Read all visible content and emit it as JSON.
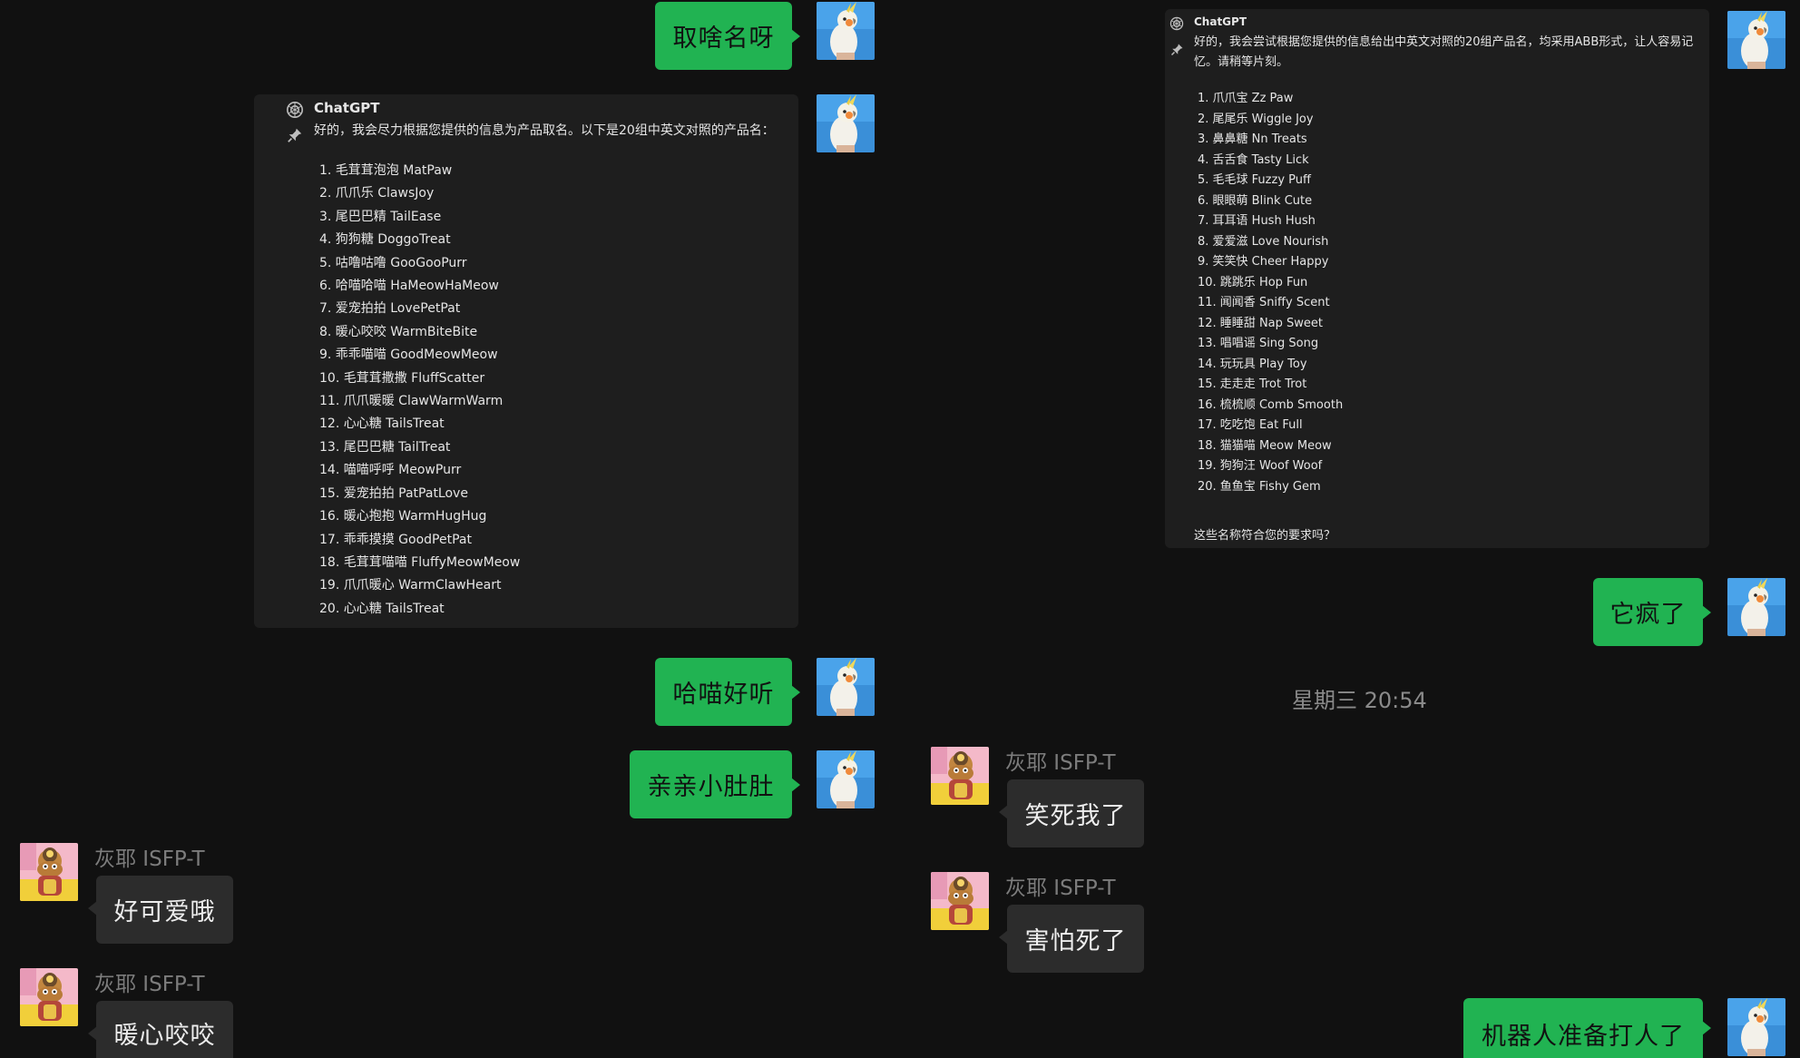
{
  "left_chat": {
    "msg_top": "取啥名呀",
    "card": {
      "name": "ChatGPT",
      "intro": "好的，我会尽力根据您提供的信息为产品取名。以下是20组中英文对照的产品名：",
      "items": [
        "1. 毛茸茸泡泡 MatPaw",
        "2. 爪爪乐 ClawsJoy",
        "3. 尾巴巴精 TailEase",
        "4. 狗狗糖 DoggoTreat",
        "5. 咕噜咕噜 GooGooPurr",
        "6. 哈喵哈喵 HaMeowHaMeow",
        "7. 爱宠拍拍 LovePetPat",
        "8. 暖心咬咬 WarmBiteBite",
        "9. 乖乖喵喵 GoodMeowMeow",
        "10. 毛茸茸撒撒 FluffScatter",
        "11. 爪爪暖暖 ClawWarmWarm",
        "12. 心心糖 TailsTreat",
        "13. 尾巴巴糖 TailTreat",
        "14. 喵喵呼呼 MeowPurr",
        "15. 爱宠拍拍 PatPatLove",
        "16. 暖心抱抱 WarmHugHug",
        "17. 乖乖摸摸 GoodPetPat",
        "18. 毛茸茸喵喵 FluffyMeowMeow",
        "19. 爪爪暖心 WarmClawHeart",
        "20. 心心糖 TailsTreat"
      ]
    },
    "msg_2": "哈喵好听",
    "msg_3": "亲亲小肚肚",
    "incoming": [
      {
        "sender": "灰耶 ISFP-T",
        "text": "好可爱哦"
      },
      {
        "sender": "灰耶 ISFP-T",
        "text": "暖心咬咬"
      }
    ]
  },
  "right_chat": {
    "card": {
      "name": "ChatGPT",
      "intro": "好的，我会尝试根据您提供的信息给出中英文对照的20组产品名，均采用ABB形式，让人容易记忆。请稍等片刻。",
      "items": [
        "1. 爪爪宝 Zz Paw",
        "2. 尾尾乐 Wiggle Joy",
        "3. 鼻鼻糖 Nn Treats",
        "4. 舌舌食 Tasty Lick",
        "5. 毛毛球 Fuzzy Puff",
        "6. 眼眼萌 Blink Cute",
        "7. 耳耳语 Hush Hush",
        "8. 爱爱滋 Love Nourish",
        "9. 笑笑快 Cheer Happy",
        "10. 跳跳乐 Hop Fun",
        "11. 闻闻香 Sniffy Scent",
        "12. 睡睡甜 Nap Sweet",
        "13. 唱唱谣 Sing Song",
        "14. 玩玩具 Play Toy",
        "15. 走走走 Trot Trot",
        "16. 梳梳顺 Comb Smooth",
        "17. 吃吃饱 Eat Full",
        "18. 猫猫喵 Meow Meow",
        "19. 狗狗汪 Woof Woof",
        "20. 鱼鱼宝 Fishy Gem"
      ],
      "outro": "这些名称符合您的要求吗？"
    },
    "msg_1": "它疯了",
    "timestamp": "星期三 20:54",
    "incoming": [
      {
        "sender": "灰耶 ISFP-T",
        "text": "笑死我了"
      },
      {
        "sender": "灰耶 ISFP-T",
        "text": "害怕死了"
      }
    ],
    "msg_last": "机器人准备打人了"
  },
  "colors": {
    "background": "#111111",
    "outgoing_bubble": "#21b352",
    "incoming_bubble": "#2c2c2c",
    "card": "#1e1e1e",
    "sender": "#7c7c7c"
  },
  "icons": [
    "openai-logo-icon",
    "pin-icon",
    "parrot-avatar",
    "cartoon-avatar"
  ]
}
